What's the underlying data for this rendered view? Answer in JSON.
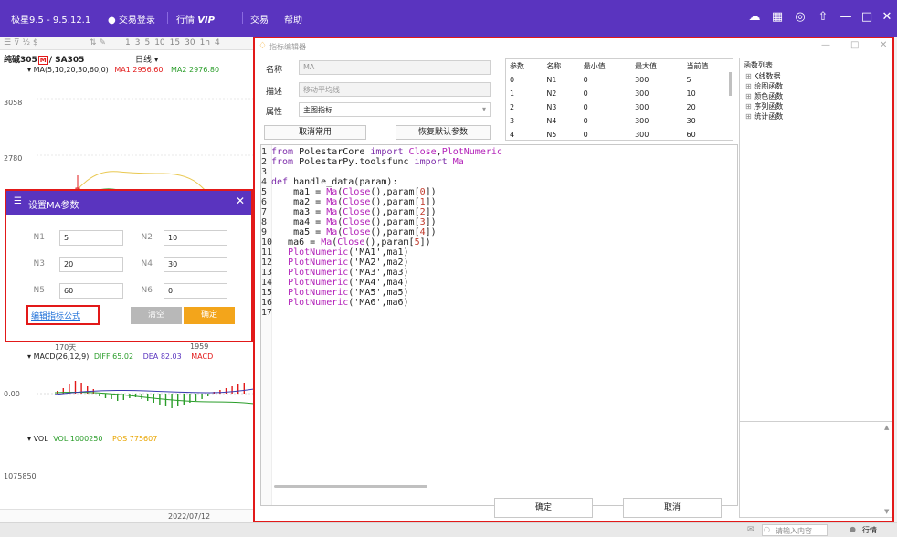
{
  "topbar": {
    "app_title": "极星9.5 - 9.5.12.1",
    "login": "交易登录",
    "market": "行情",
    "vip": "VIP",
    "trade": "交易",
    "help": "帮助"
  },
  "chart": {
    "period_buttons": [
      "1",
      "3",
      "5",
      "10",
      "15",
      "30",
      "1h",
      "4"
    ],
    "symbol": "纯碱305",
    "symbol_badge": "M",
    "symbol_code": "/ SA305",
    "period": "日线",
    "ma_legend": "MA(5,10,20,30,60,0)",
    "ma1": "MA1 2956.60",
    "ma2": "MA2 2976.80",
    "price_ticks": [
      "3058",
      "2780"
    ],
    "days_label": "170天",
    "year_label": "1959",
    "macd_legend": "MACD(26,12,9)",
    "diff": "DIFF 65.02",
    "dea": "DEA 82.03",
    "macd": "MACD",
    "macd_zero": "0.00",
    "vol_legend": "VOL",
    "vol_value": "VOL 1000250",
    "pos_value": "POS 775607",
    "vol_tick": "1075850",
    "date_label": "2022/07/12"
  },
  "ma_dialog": {
    "title": "设置MA参数",
    "fields": [
      {
        "label": "N1",
        "value": "5"
      },
      {
        "label": "N2",
        "value": "10"
      },
      {
        "label": "N3",
        "value": "20"
      },
      {
        "label": "N4",
        "value": "30"
      },
      {
        "label": "N5",
        "value": "60"
      },
      {
        "label": "N6",
        "value": "0"
      }
    ],
    "edit_link": "编辑指标公式",
    "clear_button": "清空",
    "ok_button": "确定"
  },
  "editor": {
    "title": "指标编辑器",
    "name_label": "名称",
    "name_value": "MA",
    "desc_label": "描述",
    "desc_value": "移动平均线",
    "attr_label": "属性",
    "attr_value": "主图指标",
    "cancel_common_button": "取消常用",
    "restore_default_button": "恢复默认参数",
    "param_headers": [
      "参数",
      "名称",
      "最小值",
      "最大值",
      "当前值"
    ],
    "param_rows": [
      [
        "0",
        "N1",
        "0",
        "300",
        "5"
      ],
      [
        "1",
        "N2",
        "0",
        "300",
        "10"
      ],
      [
        "2",
        "N3",
        "0",
        "300",
        "20"
      ],
      [
        "3",
        "N4",
        "0",
        "300",
        "30"
      ],
      [
        "4",
        "N5",
        "0",
        "300",
        "60"
      ]
    ],
    "func_list_title": "函数列表",
    "func_list": [
      "K线数据",
      "绘图函数",
      "颜色函数",
      "序列函数",
      "统计函数"
    ],
    "ok_button": "确定",
    "cancel_button": "取消"
  },
  "status": {
    "search_placeholder": "请输入内容",
    "market_label": "行情"
  }
}
